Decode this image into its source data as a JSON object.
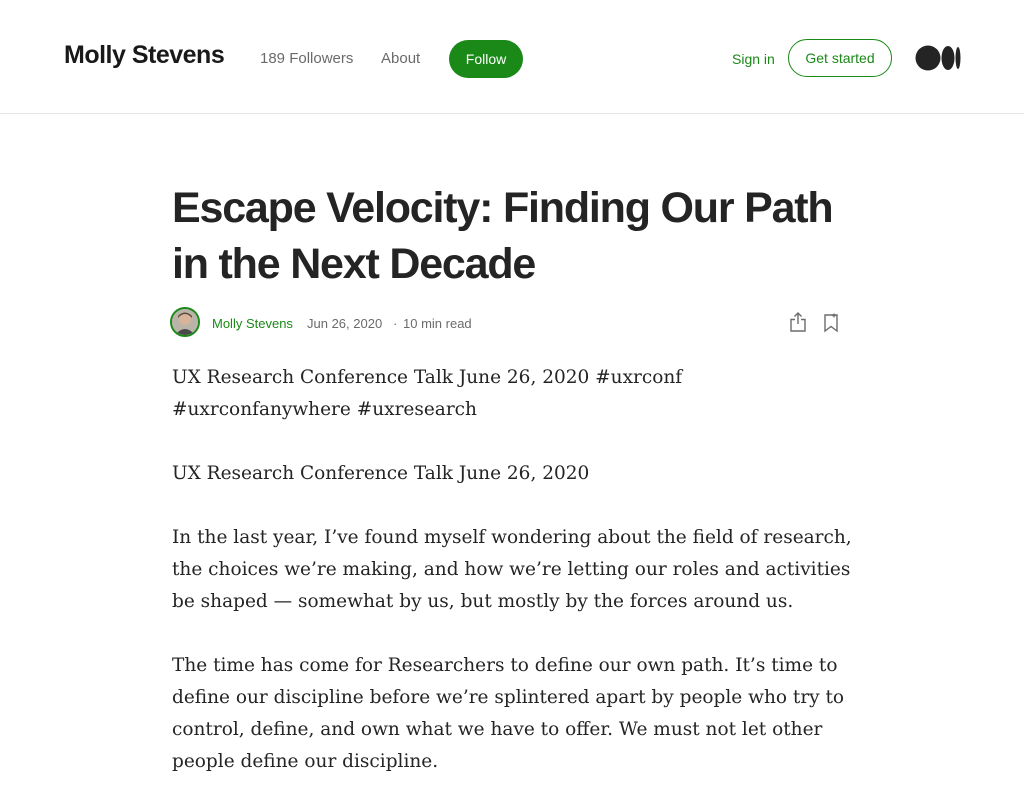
{
  "header": {
    "publication_name": "Molly Stevens",
    "followers": "189 Followers",
    "about": "About",
    "follow_button": "Follow",
    "sign_in": "Sign in",
    "get_started": "Get started",
    "logo_icon": "medium-logo-icon"
  },
  "article": {
    "title": "Escape Velocity: Finding Our Path in the Next Decade",
    "author": "Molly Stevens",
    "date": "Jun 26, 2020",
    "separator": "·",
    "read_time": "10 min read",
    "paragraphs": [
      "UX Research Conference Talk June 26, 2020 #uxrconf #uxrconfanywhere #uxresearch",
      "UX Research Conference Talk June 26, 2020",
      "In the last year, I’ve found myself wondering about the field of research, the choices we’re making, and how we’re letting our roles and activities be shaped — somewhat by us, but mostly by the forces around us.",
      "The time has come for Researchers to define our own path. It’s time to define our discipline before we’re splintered apart by people who try to control, define, and own what we have to offer. We must not let other people define our discipline."
    ]
  },
  "colors": {
    "accent_green": "#1a8917",
    "text_primary": "#242424",
    "text_secondary": "#6b6b6b"
  }
}
